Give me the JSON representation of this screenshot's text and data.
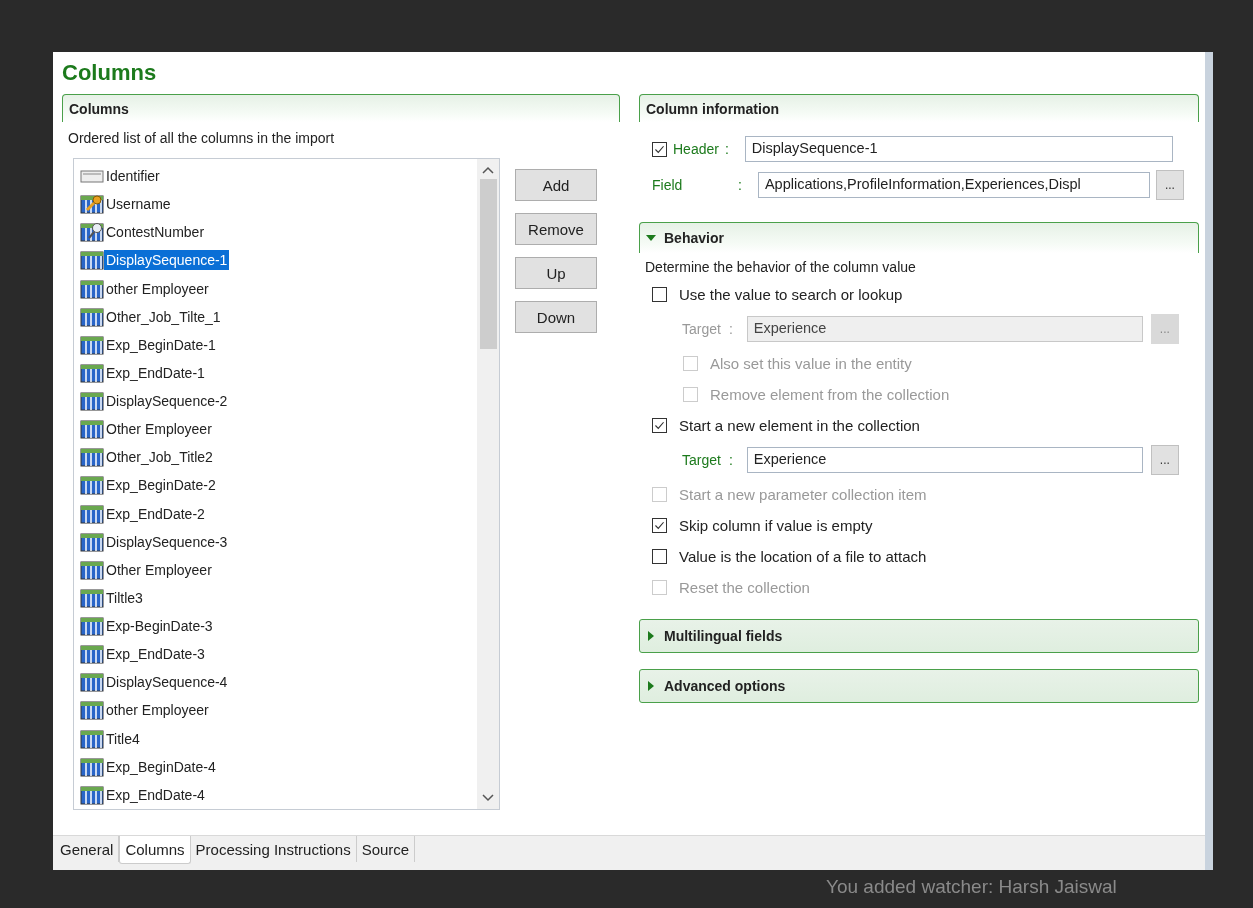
{
  "dialog": {
    "title": "Columns"
  },
  "columns_group": {
    "title": "Columns",
    "description": "Ordered list of all the columns in the import",
    "items": [
      {
        "label": "Identifier",
        "kind": "identifier",
        "selected": false
      },
      {
        "label": "Username",
        "kind": "key",
        "selected": false
      },
      {
        "label": "ContestNumber",
        "kind": "lookup",
        "selected": false
      },
      {
        "label": "DisplaySequence-1",
        "kind": "column",
        "selected": true
      },
      {
        "label": "other Employeer",
        "kind": "column",
        "selected": false
      },
      {
        "label": "Other_Job_Tilte_1",
        "kind": "column",
        "selected": false
      },
      {
        "label": "Exp_BeginDate-1",
        "kind": "column",
        "selected": false
      },
      {
        "label": "Exp_EndDate-1",
        "kind": "column",
        "selected": false
      },
      {
        "label": "DisplaySequence-2",
        "kind": "column",
        "selected": false
      },
      {
        "label": "Other Employeer",
        "kind": "column",
        "selected": false
      },
      {
        "label": "Other_Job_Title2",
        "kind": "column",
        "selected": false
      },
      {
        "label": "Exp_BeginDate-2",
        "kind": "column",
        "selected": false
      },
      {
        "label": "Exp_EndDate-2",
        "kind": "column",
        "selected": false
      },
      {
        "label": "DisplaySequence-3",
        "kind": "column",
        "selected": false
      },
      {
        "label": "Other Employeer",
        "kind": "column",
        "selected": false
      },
      {
        "label": "Tiltle3",
        "kind": "column",
        "selected": false
      },
      {
        "label": "Exp-BeginDate-3",
        "kind": "column",
        "selected": false
      },
      {
        "label": "Exp_EndDate-3",
        "kind": "column",
        "selected": false
      },
      {
        "label": "DisplaySequence-4",
        "kind": "column",
        "selected": false
      },
      {
        "label": "other Employeer",
        "kind": "column",
        "selected": false
      },
      {
        "label": "Title4",
        "kind": "column",
        "selected": false
      },
      {
        "label": "Exp_BeginDate-4",
        "kind": "column",
        "selected": false
      },
      {
        "label": "Exp_EndDate-4",
        "kind": "column",
        "selected": false
      }
    ]
  },
  "list_buttons": [
    "Add",
    "Remove",
    "Up",
    "Down"
  ],
  "column_information": {
    "title": "Column information",
    "header": {
      "checked": true,
      "label": "Header",
      "colon": ":",
      "value": "DisplaySequence-1"
    },
    "field": {
      "label": "Field",
      "colon": ":",
      "value": "Applications,ProfileInformation,Experiences,Displ",
      "button": "..."
    }
  },
  "behavior": {
    "title": "Behavior",
    "expanded": true,
    "description": "Determine the behavior of the column value",
    "options": [
      {
        "kind": "checkbox",
        "label": "Use the value to search or lookup",
        "checked": false,
        "disabled": false,
        "children": [
          {
            "kind": "target",
            "label": "Target",
            "colon": ":",
            "value": "Experience",
            "button": "...",
            "disabled": true
          },
          {
            "kind": "checkbox",
            "label": "Also set this value in the entity",
            "checked": false,
            "disabled": true
          },
          {
            "kind": "checkbox",
            "label": "Remove element from the collection",
            "checked": false,
            "disabled": true
          }
        ]
      },
      {
        "kind": "checkbox",
        "label": "Start a new element in the collection",
        "checked": true,
        "disabled": false,
        "children": [
          {
            "kind": "target",
            "label": "Target",
            "colon": ":",
            "value": "Experience",
            "button": "...",
            "disabled": false
          }
        ]
      },
      {
        "kind": "checkbox",
        "label": "Start a new parameter collection item",
        "checked": false,
        "disabled": true
      },
      {
        "kind": "checkbox",
        "label": "Skip column if value is empty",
        "checked": true,
        "disabled": false
      },
      {
        "kind": "checkbox",
        "label": "Value is the location of a file to attach",
        "checked": false,
        "disabled": false
      },
      {
        "kind": "checkbox",
        "label": "Reset the collection",
        "checked": false,
        "disabled": true
      }
    ]
  },
  "sections": [
    {
      "title": "Multilingual fields",
      "expanded": false
    },
    {
      "title": "Advanced options",
      "expanded": false
    }
  ],
  "tabs": [
    {
      "label": "General",
      "selected": false
    },
    {
      "label": "Columns",
      "selected": true
    },
    {
      "label": "Processing Instructions",
      "selected": false
    },
    {
      "label": "Source",
      "selected": false
    }
  ],
  "background": {
    "notice": "You added watcher: Harsh Jaiswal"
  }
}
